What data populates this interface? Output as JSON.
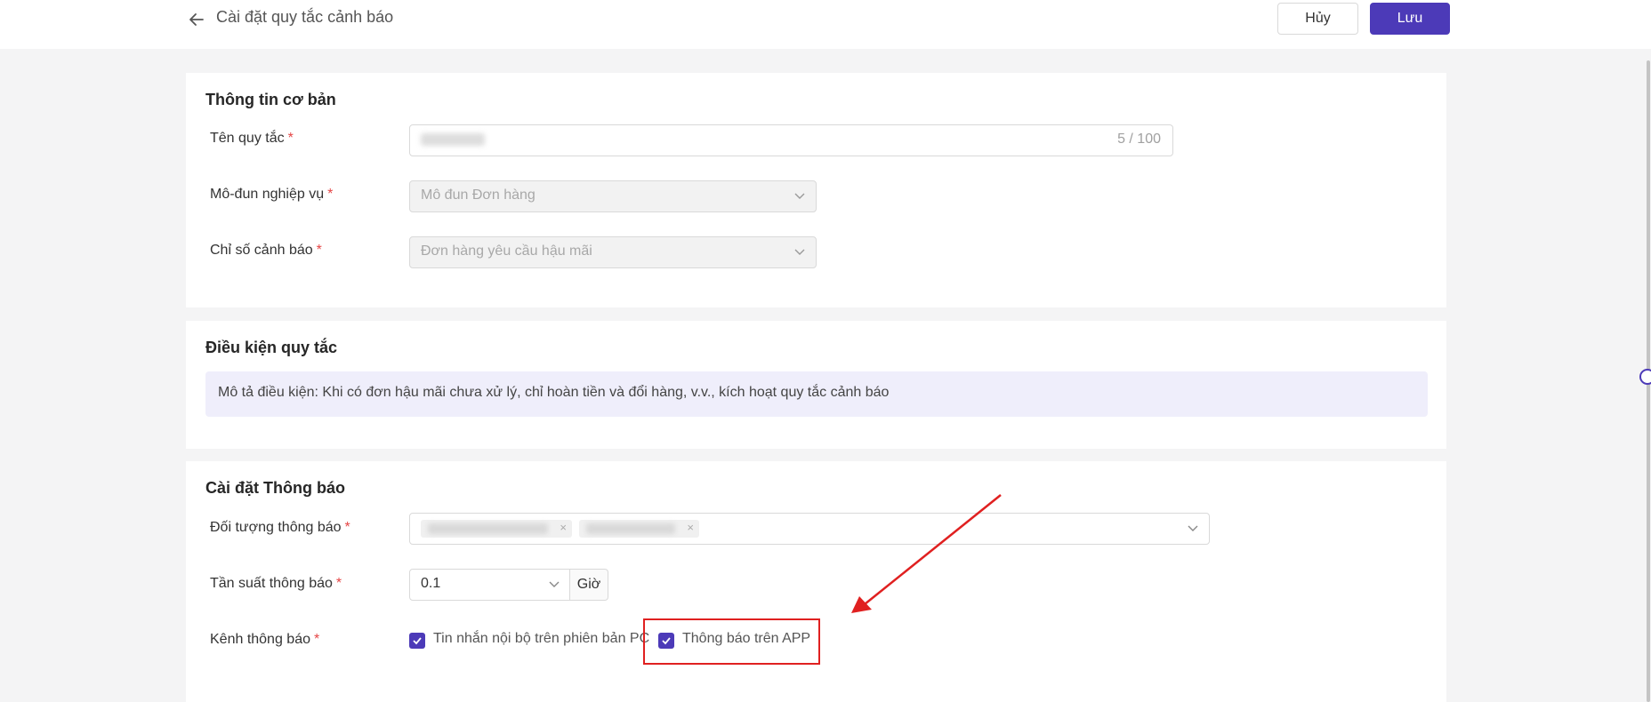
{
  "header": {
    "title": "Cài đặt quy tắc cảnh báo",
    "cancel_label": "Hủy",
    "save_label": "Lưu"
  },
  "basic_info": {
    "title": "Thông tin cơ bản",
    "rule_name_label": "Tên quy tắc",
    "rule_name_counter": "5 / 100",
    "module_label": "Mô-đun nghiệp vụ",
    "module_value": "Mô đun Đơn hàng",
    "metric_label": "Chỉ số cảnh báo",
    "metric_value": "Đơn hàng yêu cầu hậu mãi"
  },
  "rule_conditions": {
    "title": "Điều kiện quy tắc",
    "description": "Mô tả điều kiện: Khi có đơn hậu mãi chưa xử lý, chỉ hoàn tiền và đổi hàng, v.v., kích hoạt quy tắc cảnh báo"
  },
  "notification_settings": {
    "title": "Cài đặt Thông báo",
    "target_label": "Đối tượng thông báo",
    "frequency_label": "Tần suất thông báo",
    "frequency_value": "0.1",
    "frequency_unit": "Giờ",
    "channel_label": "Kênh thông báo",
    "channel_pc": "Tin nhắn nội bộ trên phiên bản PC",
    "channel_app": "Thông báo trên APP"
  },
  "required_mark": "*",
  "colors": {
    "accent": "#4c3ab8",
    "required": "#e54545",
    "annotation": "#e02020"
  }
}
